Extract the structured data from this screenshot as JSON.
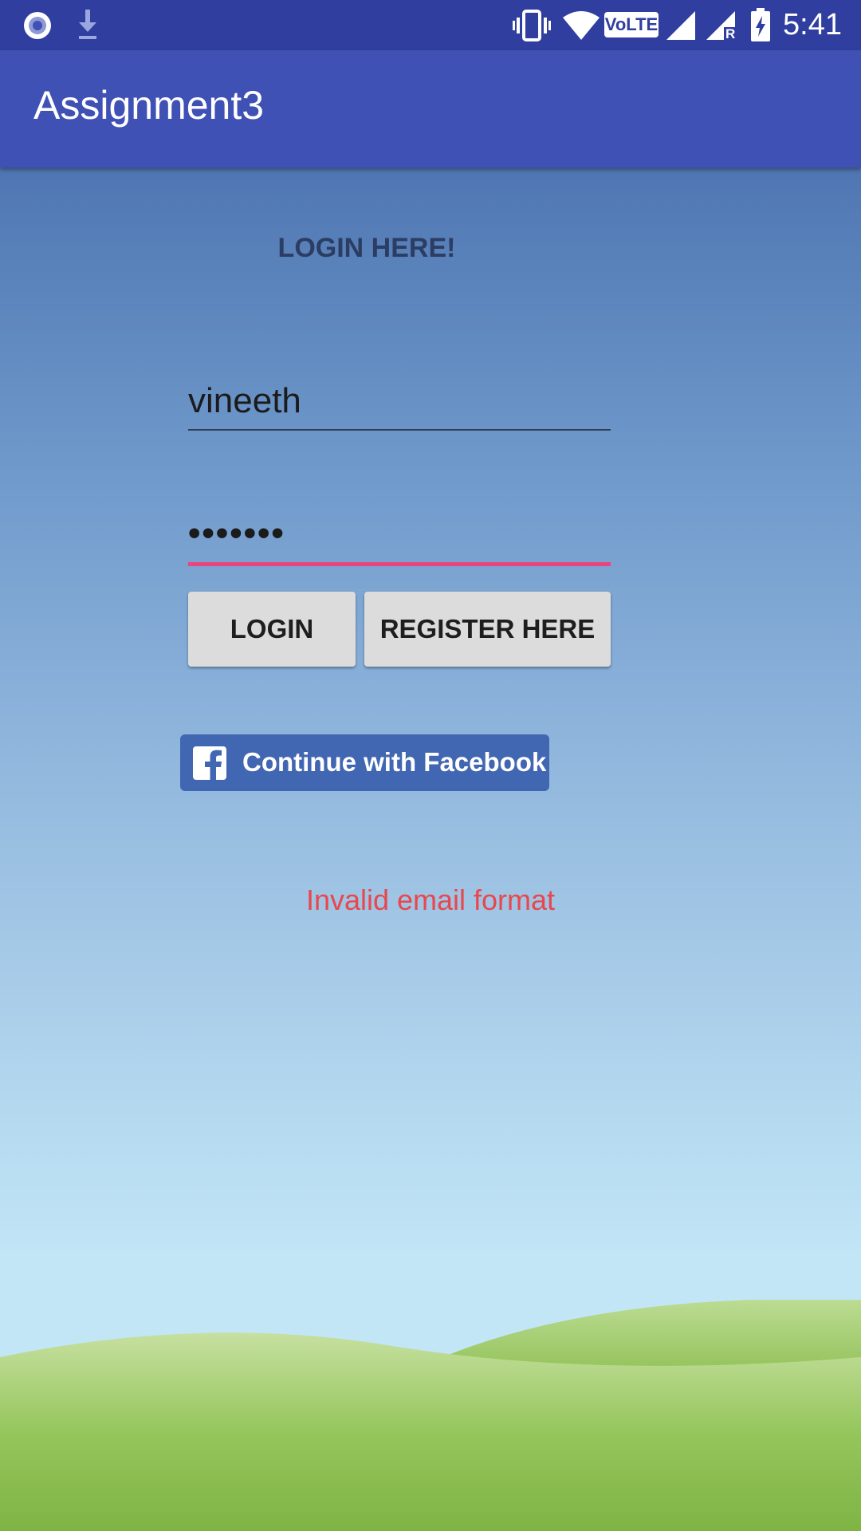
{
  "status_bar": {
    "time": "5:41",
    "icons": [
      "record-icon",
      "download-icon",
      "vibrate-icon",
      "wifi-icon",
      "volte-badge",
      "signal-icon",
      "signal-roaming-icon",
      "battery-charging-icon"
    ],
    "volte_label": "VoLTE",
    "roaming_label": "R"
  },
  "app_bar": {
    "title": "Assignment3"
  },
  "login": {
    "heading": "LOGIN HERE!",
    "username_value": "vineeth",
    "password_mask": "•••••••",
    "login_button": "LOGIN",
    "register_button": "REGISTER HERE",
    "facebook_button": "Continue with Facebook",
    "error_message": "Invalid email format"
  },
  "colors": {
    "status_bar": "#303f9f",
    "app_bar": "#3f51b5",
    "accent": "#e8457e",
    "facebook": "#4267b2",
    "error": "#e9474d",
    "hill_green": "#7cb342"
  }
}
